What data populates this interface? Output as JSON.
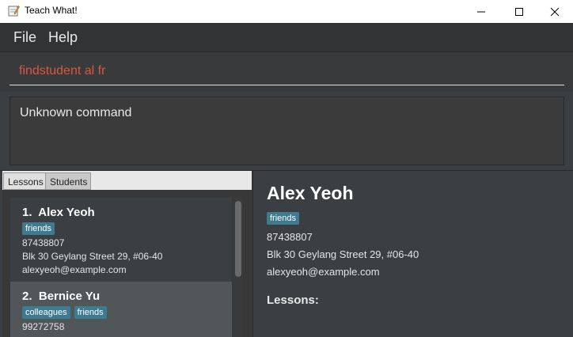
{
  "window": {
    "title": "Teach What!"
  },
  "menu": {
    "items": [
      "File",
      "Help"
    ]
  },
  "command": {
    "value": "findstudent al fr"
  },
  "result": {
    "message": "Unknown command"
  },
  "tabs": [
    {
      "label": "Lessons"
    },
    {
      "label": "Students"
    }
  ],
  "students": [
    {
      "index": "1.",
      "name": "Alex Yeoh",
      "tags": [
        "friends"
      ],
      "phone": "87438807",
      "address": "Blk 30 Geylang Street 29, #06-40",
      "email": "alexyeoh@example.com"
    },
    {
      "index": "2.",
      "name": "Bernice Yu",
      "tags": [
        "colleagues",
        "friends"
      ],
      "phone": "99272758"
    }
  ],
  "detail": {
    "name": "Alex Yeoh",
    "tags": [
      "friends"
    ],
    "phone": "87438807",
    "address": "Blk 30 Geylang Street 29, #06-40",
    "email": "alexyeoh@example.com",
    "lessons_label": "Lessons:"
  },
  "colors": {
    "accent_tag": "#3e7b91",
    "command_text": "#d9573d"
  },
  "icons": {
    "app": "notepad-pencil-icon",
    "minimize": "minimize-icon",
    "maximize": "maximize-icon",
    "close": "close-icon"
  }
}
